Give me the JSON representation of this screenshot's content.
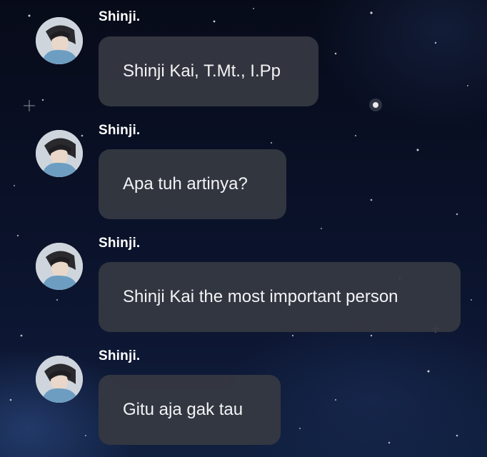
{
  "messages": [
    {
      "sender": "Shinji.",
      "text": "Shinji Kai, T.Mt., I.Pp",
      "avatar_icon": "user-avatar"
    },
    {
      "sender": "Shinji.",
      "text": "Apa tuh artinya?",
      "avatar_icon": "user-avatar"
    },
    {
      "sender": "Shinji.",
      "text": "Shinji Kai the most important person",
      "avatar_icon": "user-avatar"
    },
    {
      "sender": "Shinji.",
      "text": "Gitu aja gak tau",
      "avatar_icon": "user-avatar"
    }
  ],
  "theme": {
    "background": "#0a1128",
    "bubble": "#363942",
    "text": "#f2f3f5",
    "sender_name": "#ffffff"
  }
}
